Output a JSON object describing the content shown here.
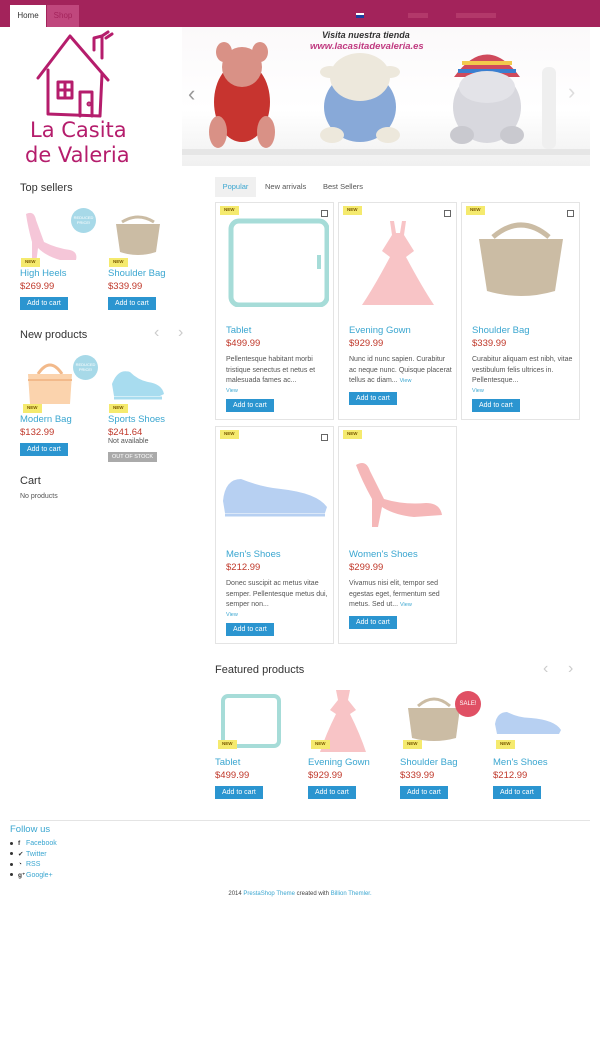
{
  "nav": {
    "home": "Home",
    "shop": "Shop"
  },
  "banner": {
    "line1": "Visita nuestra tienda",
    "line2": "www.lacasitadevaleria.es"
  },
  "logo_text": [
    "La Casita",
    "de Valeria"
  ],
  "top_sellers": {
    "title": "Top sellers",
    "items": [
      {
        "name": "High Heels",
        "price": "$269.99",
        "badge": "NEW",
        "reduced": "REDUCED PRICE!",
        "button": "Add to cart"
      },
      {
        "name": "Shoulder Bag",
        "price": "$339.99",
        "badge": "NEW",
        "button": "Add to cart"
      }
    ]
  },
  "new_products": {
    "title": "New products",
    "items": [
      {
        "name": "Modern Bag",
        "price": "$132.99",
        "badge": "NEW",
        "reduced": "REDUCED PRICE!",
        "button": "Add to cart"
      },
      {
        "name": "Sports Shoes",
        "price": "$241.64",
        "badge": "NEW",
        "availability": "Not available",
        "stock": "OUT OF STOCK"
      }
    ]
  },
  "cart": {
    "title": "Cart",
    "empty": "No products"
  },
  "tabs": [
    "Popular",
    "New arrivals",
    "Best Sellers"
  ],
  "products": [
    {
      "name": "Tablet",
      "price": "$499.99",
      "badge": "NEW",
      "desc": "Pellentesque habitant morbi tristique senectus et netus et malesuada fames ac...",
      "more": "View",
      "button": "Add to cart"
    },
    {
      "name": "Evening Gown",
      "price": "$929.99",
      "badge": "NEW",
      "desc": "Nunc id nunc sapien. Curabitur ac neque nunc. Quisque placerat tellus ac diam...",
      "more": "View",
      "button": "Add to cart"
    },
    {
      "name": "Shoulder Bag",
      "price": "$339.99",
      "badge": "NEW",
      "desc": "Curabitur aliquam est nibh, vitae vestibulum felis ultrices in. Pellentesque...",
      "more": "View",
      "button": "Add to cart"
    },
    {
      "name": "Men's Shoes",
      "price": "$212.99",
      "badge": "NEW",
      "desc": "Donec suscipit ac metus vitae semper. Pellentesque metus dui, semper non...",
      "more": "View",
      "button": "Add to cart"
    },
    {
      "name": "Women's Shoes",
      "price": "$299.99",
      "badge": "NEW",
      "desc": "Vivamus nisi elit, tempor sed egestas eget, fermentum sed metus. Sed ut...",
      "more": "View",
      "button": "Add to cart"
    }
  ],
  "featured": {
    "title": "Featured products",
    "items": [
      {
        "name": "Tablet",
        "price": "$499.99",
        "badge": "NEW",
        "button": "Add to cart"
      },
      {
        "name": "Evening Gown",
        "price": "$929.99",
        "badge": "NEW",
        "button": "Add to cart"
      },
      {
        "name": "Shoulder Bag",
        "price": "$339.99",
        "badge": "NEW",
        "sale": "SALE!",
        "button": "Add to cart"
      },
      {
        "name": "Men's Shoes",
        "price": "$212.99",
        "badge": "NEW",
        "button": "Add to cart"
      }
    ]
  },
  "follow": {
    "title": "Follow us",
    "links": [
      "Facebook",
      "Twitter",
      "RSS",
      "Google+"
    ]
  },
  "footer": {
    "year": "2014",
    "link1": "PrestaShop Theme",
    "mid": "created with",
    "link2": "Billion Themler."
  },
  "colors": {
    "brand": "#a3235b",
    "button": "#2b95d0",
    "price": "#c0392b",
    "link": "#3aa6d0",
    "badge": "#f5ea6e"
  },
  "icons": [
    "prev-arrow-icon",
    "next-arrow-icon",
    "facebook-icon",
    "twitter-icon",
    "rss-icon",
    "google-plus-icon"
  ]
}
